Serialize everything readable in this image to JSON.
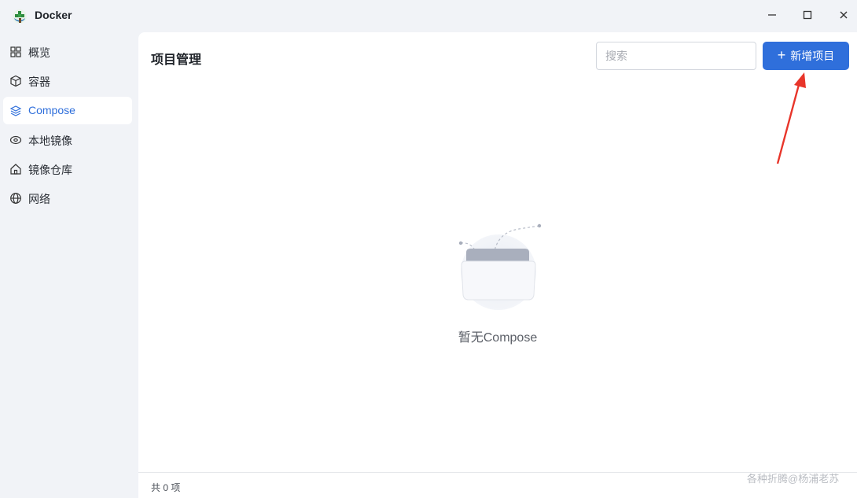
{
  "window": {
    "title": "Docker",
    "controls": [
      "minimize-icon",
      "maximize-icon",
      "close-icon"
    ]
  },
  "sidebar": {
    "items": [
      {
        "label": "概览",
        "icon": "grid-icon",
        "active": false
      },
      {
        "label": "容器",
        "icon": "cube-icon",
        "active": false
      },
      {
        "label": "Compose",
        "icon": "layers-icon",
        "active": true
      },
      {
        "label": "本地镜像",
        "icon": "disk-icon",
        "active": false
      },
      {
        "label": "镜像仓库",
        "icon": "home-icon",
        "active": false
      },
      {
        "label": "网络",
        "icon": "globe-icon",
        "active": false
      }
    ]
  },
  "main": {
    "title": "项目管理",
    "search": {
      "placeholder": "搜索",
      "value": ""
    },
    "add_button": {
      "label": "新增项目",
      "icon": "plus-icon"
    },
    "empty_state": {
      "text": "暂无Compose",
      "icon": "empty-folder-illustration"
    },
    "footer": {
      "count_text": "共 0 项"
    },
    "watermark": "各种折腾@杨浦老苏"
  },
  "colors": {
    "accent": "#2f6fdb",
    "background": "#f1f3f7",
    "panel": "#ffffff",
    "annotation_arrow": "#e8352a"
  }
}
